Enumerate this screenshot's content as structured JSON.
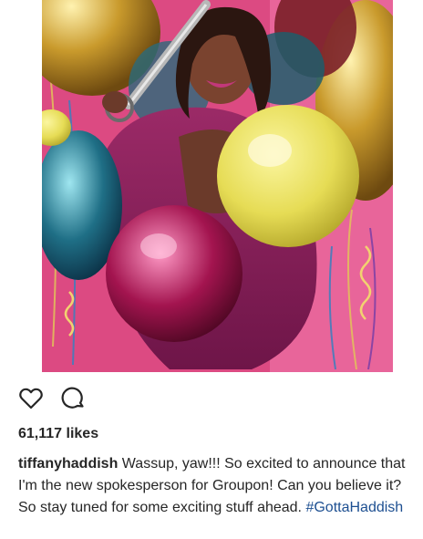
{
  "post": {
    "image_alt": "",
    "likes_text": "61,117 likes",
    "caption": {
      "username": "tiffanyhaddish",
      "text": "Wassup, yaw!!! So excited to announce that I'm the new spokesperson for Groupon! Can you believe it? So stay tuned for some exciting stuff ahead.",
      "hashtag": "#GottaHaddish"
    },
    "actions": {
      "like_icon": "heart-outline-icon",
      "comment_icon": "speech-bubble-icon"
    }
  },
  "colors": {
    "hashtag": "#1d4f91",
    "text": "#262626",
    "photo_background": "#d9467d"
  }
}
